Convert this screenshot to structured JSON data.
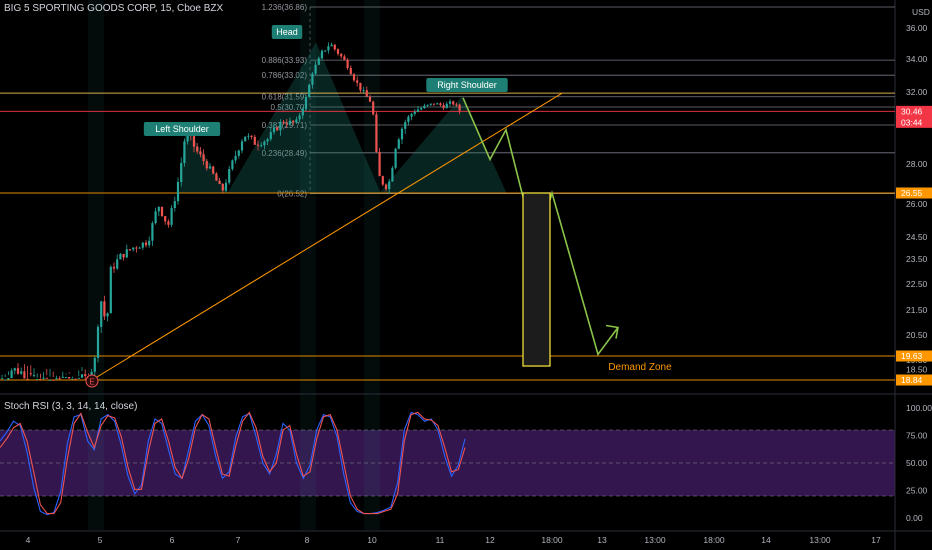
{
  "header": {
    "symbol_line": "BIG 5 SPORTING GOODS CORP, 15, Cboe BZX",
    "currency": "USD"
  },
  "oscillator": {
    "label": "Stoch RSI (3, 3, 14, 14, close)"
  },
  "chart_data": [
    {
      "type": "candlestick",
      "title": "BIG 5 SPORTING GOODS CORP, 15, Cboe BZX",
      "price_axis": {
        "currency": "USD",
        "ticks": [
          "36.00",
          "34.00",
          "32.00",
          "30.00",
          "28.00",
          "26.00",
          "24.50",
          "23.50",
          "22.50",
          "21.50",
          "20.50",
          "19.50",
          "18.50"
        ],
        "current_price": "30.46",
        "countdown": "03:44",
        "markers": [
          "26.55",
          "19.63",
          "18.84"
        ]
      },
      "time_axis": {
        "ticks": [
          "4",
          "5",
          "6",
          "7",
          "8",
          "10",
          "11",
          "12",
          "18:00",
          "13",
          "13:00",
          "18:00",
          "14",
          "13:00",
          "18:00",
          "17"
        ]
      },
      "price_path": [
        [
          0,
          18.7
        ],
        [
          12,
          19.2
        ],
        [
          22,
          19.1
        ],
        [
          30,
          18.6
        ],
        [
          50,
          18.7
        ],
        [
          70,
          18.8
        ],
        [
          88,
          18.9
        ],
        [
          95,
          19.5
        ],
        [
          100,
          22.0
        ],
        [
          104,
          21.5
        ],
        [
          106,
          20.3
        ],
        [
          110,
          23.0
        ],
        [
          120,
          23.6
        ],
        [
          132,
          24.0
        ],
        [
          148,
          24.3
        ],
        [
          158,
          26.0
        ],
        [
          168,
          25.0
        ],
        [
          176,
          26.5
        ],
        [
          186,
          29.5
        ],
        [
          196,
          28.6
        ],
        [
          206,
          28.0
        ],
        [
          214,
          27.4
        ],
        [
          222,
          26.6
        ],
        [
          232,
          28.0
        ],
        [
          244,
          29.3
        ],
        [
          256,
          28.9
        ],
        [
          268,
          29.1
        ],
        [
          282,
          29.9
        ],
        [
          296,
          29.8
        ],
        [
          304,
          30.9
        ],
        [
          312,
          33.2
        ],
        [
          318,
          33.8
        ],
        [
          322,
          34.4
        ],
        [
          330,
          35.0
        ],
        [
          338,
          34.4
        ],
        [
          348,
          33.6
        ],
        [
          356,
          32.6
        ],
        [
          364,
          31.9
        ],
        [
          372,
          31.0
        ],
        [
          376,
          28.5
        ],
        [
          380,
          27.2
        ],
        [
          388,
          26.8
        ],
        [
          396,
          28.9
        ],
        [
          404,
          29.8
        ],
        [
          414,
          30.5
        ],
        [
          424,
          30.7
        ],
        [
          434,
          31.0
        ],
        [
          444,
          30.8
        ],
        [
          452,
          31.1
        ],
        [
          460,
          30.5
        ]
      ],
      "fibonacci": [
        {
          "label": "1.236(36.86)",
          "price": 36.86
        },
        {
          "label": "0.886(33.93)",
          "price": 33.93
        },
        {
          "label": "0.786(33.02)",
          "price": 33.02
        },
        {
          "label": "0.618(31.59)",
          "price": 31.59
        },
        {
          "label": "0.5(30.70)",
          "price": 30.7
        },
        {
          "label": "0.382(29.71)",
          "price": 29.71
        },
        {
          "label": "0.236(28.49)",
          "price": 28.49
        },
        {
          "label": "0(26.52)",
          "price": 26.52
        }
      ],
      "horizontal_lines": [
        {
          "price": 31.9,
          "color": "#f0c05a"
        },
        {
          "price": 30.46,
          "color": "#f23645"
        },
        {
          "price": 26.55,
          "color": "#ff9800"
        },
        {
          "price": 19.63,
          "color": "#ff9800"
        },
        {
          "price": 18.84,
          "color": "#ff9800"
        }
      ],
      "pattern_labels": [
        "Left Shoulder",
        "Head",
        "Right Shoulder"
      ],
      "zone_label": "Demand Zone",
      "event_marker": "E",
      "projection": [
        [
          463,
          31.5
        ],
        [
          490,
          28.2
        ],
        [
          506,
          29.5
        ],
        [
          522,
          26.55
        ],
        [
          537,
          24.2
        ],
        [
          552,
          26.55
        ],
        [
          598,
          19.7
        ],
        [
          618,
          20.8
        ]
      ],
      "colors": {
        "up": "#26a69a",
        "down": "#ef5350",
        "fib": "#787b86",
        "pattern": "#1e8074",
        "projection": "#8bc34a",
        "trend": "#ff9800",
        "box": "#ffeb3b",
        "panel": "#3d1a5c"
      }
    },
    {
      "type": "line",
      "title": "Stoch RSI (3, 3, 14, 14, close)",
      "ylim": [
        0,
        100
      ],
      "y_ticks": [
        "100.00",
        "75.00",
        "50.00",
        "25.00",
        "0.00"
      ],
      "bands": [
        20,
        80
      ],
      "series": [
        {
          "color": "#2962ff",
          "x_end": 465,
          "values": [
            70,
            78,
            88,
            84,
            60,
            28,
            6,
            3,
            5,
            24,
            68,
            92,
            94,
            70,
            62,
            90,
            94,
            88,
            66,
            38,
            22,
            30,
            70,
            90,
            86,
            62,
            40,
            36,
            62,
            88,
            94,
            84,
            56,
            36,
            42,
            74,
            92,
            95,
            74,
            50,
            40,
            58,
            86,
            80,
            50,
            36,
            48,
            80,
            94,
            92,
            74,
            40,
            14,
            6,
            4,
            4,
            5,
            7,
            10,
            32,
            80,
            96,
            94,
            88,
            90,
            80,
            56,
            38,
            48,
            72
          ]
        },
        {
          "color": "#ef5350",
          "x_end": 465,
          "values": [
            64,
            72,
            82,
            86,
            70,
            42,
            12,
            4,
            4,
            14,
            54,
            86,
            95,
            78,
            64,
            84,
            93,
            91,
            74,
            46,
            26,
            26,
            60,
            86,
            90,
            70,
            46,
            36,
            54,
            82,
            94,
            90,
            64,
            40,
            38,
            66,
            88,
            96,
            82,
            56,
            42,
            50,
            80,
            84,
            58,
            38,
            42,
            72,
            92,
            94,
            80,
            50,
            20,
            8,
            4,
            4,
            4,
            6,
            8,
            22,
            70,
            94,
            96,
            90,
            89,
            84,
            64,
            42,
            44,
            64
          ]
        }
      ]
    }
  ]
}
